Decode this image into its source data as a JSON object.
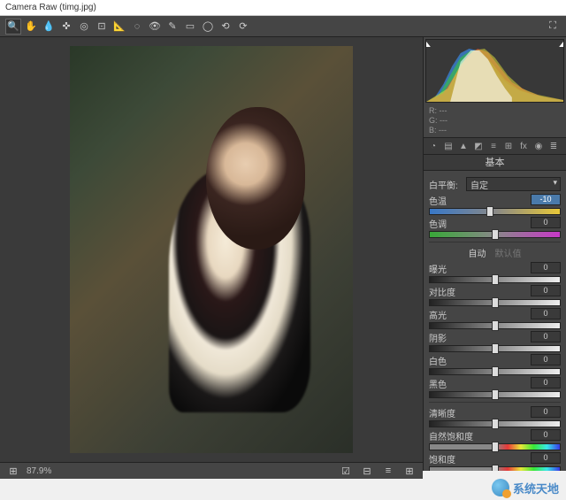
{
  "window": {
    "title": "Camera Raw (timg.jpg)"
  },
  "toolbar": {
    "tools": [
      "zoom",
      "hand",
      "white-balance",
      "color-sampler",
      "target",
      "crop",
      "straighten",
      "spot",
      "redeye",
      "brush",
      "grad",
      "radial",
      "rotate-ccw",
      "rotate-cw"
    ],
    "glyphs": [
      "🔍",
      "✋",
      "💧",
      "✜",
      "◎",
      "⊡",
      "📐",
      "◌",
      "👁",
      "✎",
      "▭",
      "◯",
      "⟲",
      "⟳"
    ],
    "fullscreen": "⛶"
  },
  "footer": {
    "compare_icon": "⊞",
    "zoom": "87.9%",
    "right_icons": [
      "☑",
      "⊟",
      "≡",
      "⊞"
    ]
  },
  "panel": {
    "rgb": {
      "r": "R:",
      "g": "G:",
      "b": "B:",
      "rv": "---",
      "gv": "---",
      "bv": "---"
    },
    "tabs": [
      "◔",
      "▤",
      "▲",
      "◩",
      "≡",
      "⊞",
      "fx",
      "◉",
      "≣"
    ],
    "header": "基本",
    "wb": {
      "label": "白平衡:",
      "value": "自定"
    },
    "auto": {
      "auto": "自动",
      "default": "默认值"
    },
    "sliders": {
      "temp": {
        "label": "色温",
        "value": "-10",
        "pos": 46,
        "hl": true
      },
      "tint": {
        "label": "色调",
        "value": "0",
        "pos": 50
      },
      "exposure": {
        "label": "曝光",
        "value": "0",
        "pos": 50
      },
      "contrast": {
        "label": "对比度",
        "value": "0",
        "pos": 50
      },
      "high": {
        "label": "高光",
        "value": "0",
        "pos": 50
      },
      "shadow": {
        "label": "阴影",
        "value": "0",
        "pos": 50
      },
      "white": {
        "label": "白色",
        "value": "0",
        "pos": 50
      },
      "black": {
        "label": "黑色",
        "value": "0",
        "pos": 50
      },
      "clarity": {
        "label": "清晰度",
        "value": "0",
        "pos": 50
      },
      "vibrance": {
        "label": "自然饱和度",
        "value": "0",
        "pos": 50
      },
      "sat": {
        "label": "饱和度",
        "value": "0",
        "pos": 50
      }
    }
  },
  "watermark": "系统天地"
}
